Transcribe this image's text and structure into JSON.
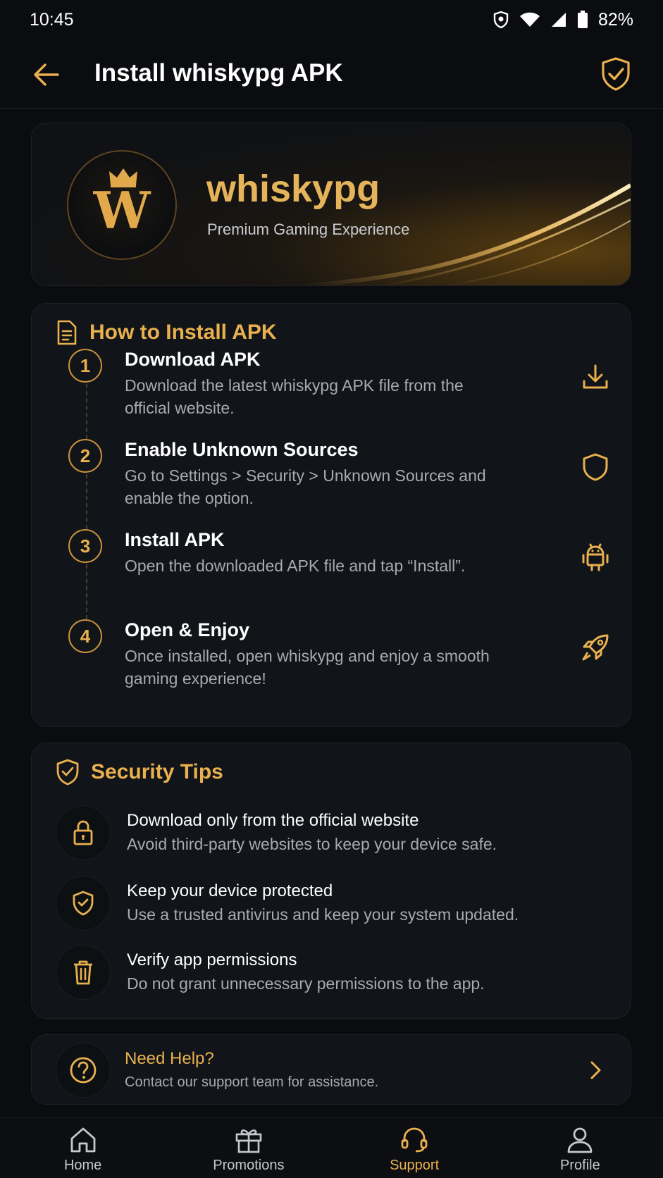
{
  "status_bar": {
    "time": "10:45",
    "battery": "82%"
  },
  "app_bar": {
    "title": "Install whiskypg APK"
  },
  "hero": {
    "logo_letter": "W",
    "brand_name": "whiskypg",
    "tagline": "Premium Gaming Experience"
  },
  "install": {
    "title": "How to Install APK",
    "steps": [
      {
        "num": "1",
        "title": "Download APK",
        "desc": "Download the latest whiskypg APK file from the official website.",
        "icon": "download-icon"
      },
      {
        "num": "2",
        "title": "Enable Unknown Sources",
        "desc": "Go to Settings > Security > Unknown Sources and enable the option.",
        "icon": "shield-icon"
      },
      {
        "num": "3",
        "title": "Install APK",
        "desc": "Open the downloaded APK file and tap “Install”.",
        "icon": "android-icon"
      },
      {
        "num": "4",
        "title": "Open & Enjoy",
        "desc": "Once installed, open whiskypg and enjoy a smooth gaming experience!",
        "icon": "rocket-icon"
      }
    ]
  },
  "security": {
    "title": "Security Tips",
    "tips": [
      {
        "title": "Download only from the official website",
        "desc": "Avoid third-party websites to keep your device safe.",
        "icon": "lock-icon"
      },
      {
        "title": "Keep your device protected",
        "desc": "Use a trusted antivirus and keep your system updated.",
        "icon": "shield-check-icon"
      },
      {
        "title": "Verify app permissions",
        "desc": "Do not grant unnecessary permissions to the app.",
        "icon": "trash-icon"
      }
    ]
  },
  "help": {
    "title": "Need Help?",
    "desc": "Contact our support team for assistance."
  },
  "nav": {
    "items": [
      {
        "label": "Home",
        "icon": "home-icon"
      },
      {
        "label": "Promotions",
        "icon": "gift-icon"
      },
      {
        "label": "Support",
        "icon": "headset-icon",
        "active": true
      },
      {
        "label": "Profile",
        "icon": "user-icon"
      }
    ]
  },
  "colors": {
    "accent": "#e9b04f",
    "background": "#0a0c0f",
    "card": "#111418"
  }
}
